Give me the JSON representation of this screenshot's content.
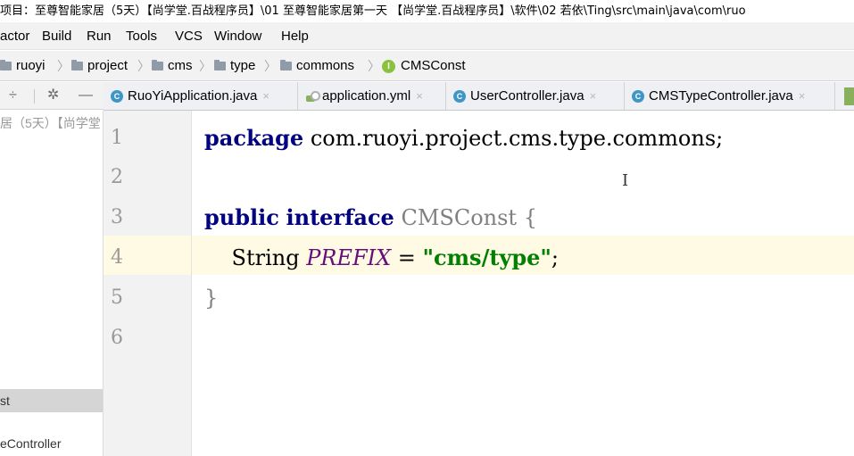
{
  "window": {
    "title": "项目：至尊智能家居（5天）【尚学堂.百战程序员】\\01 至尊智能家居第一天 【尚学堂.百战程序员】\\软件\\02 若依\\Ting\\src\\main\\java\\com\\ruo"
  },
  "menu": {
    "items": [
      "actor",
      "Build",
      "Run",
      "Tools",
      "VCS",
      "Window",
      "Help"
    ]
  },
  "breadcrumb": {
    "items": [
      "ruoyi",
      "project",
      "cms",
      "type",
      "commons",
      "CMSConst"
    ],
    "icon_names": [
      "folder-icon",
      "folder-icon",
      "folder-icon",
      "folder-icon",
      "folder-icon",
      "interface-icon"
    ]
  },
  "tool_window": {
    "icons": [
      "collapse-icon",
      "gear-icon",
      "minimize-icon"
    ]
  },
  "tabs": [
    {
      "label": "RuoYiApplication.java",
      "icon": "class-icon",
      "close": "×"
    },
    {
      "label": "application.yml",
      "icon": "yml-icon",
      "close": "×"
    },
    {
      "label": "UserController.java",
      "icon": "class-icon",
      "close": "×"
    },
    {
      "label": "CMSTypeController.java",
      "icon": "class-icon",
      "close": "×"
    }
  ],
  "sidebar": {
    "items": [
      "居（5天）【尚学堂",
      "st",
      "eController"
    ]
  },
  "editor": {
    "line_numbers": [
      "1",
      "2",
      "3",
      "4",
      "5",
      "6"
    ],
    "current_line": 4,
    "lines": {
      "l1_kw": "package",
      "l1_rest": " com.ruoyi.project.cms.type.commons;",
      "l3_kw1": "public",
      "l3_sp": " ",
      "l3_kw2": "interface",
      "l3_name": " CMSConst",
      "l3_brace": " {",
      "l4_type": "    String ",
      "l4_const": "PREFIX",
      "l4_eq": " = ",
      "l4_str": "\"cms/type\"",
      "l4_semi": ";",
      "l5": "}"
    },
    "mouse_cursor": "I"
  },
  "colors": {
    "keyword": "#000080",
    "string": "#008000",
    "constant": "#660e7a",
    "caret_row": "#fffae3",
    "gutter": "#f2f2f2"
  }
}
